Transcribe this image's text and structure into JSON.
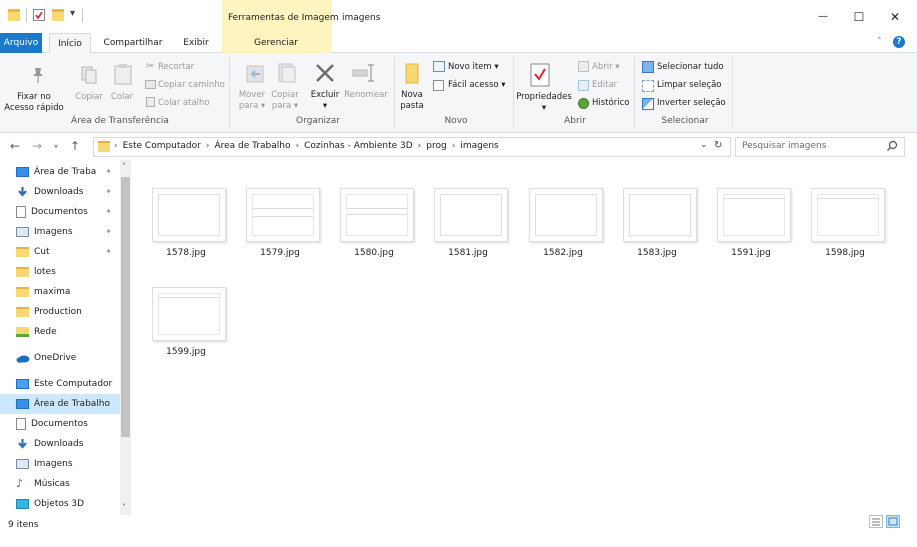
{
  "title_bar": {
    "context_tab_label": "Ferramentas de Imagem",
    "window_title": "imagens",
    "minimize_glyph": "—",
    "maximize_glyph": "☐",
    "close_glyph": "✕"
  },
  "ribbon_tabs": [
    {
      "label": "Arquivo"
    },
    {
      "label": "Início"
    },
    {
      "label": "Compartilhar"
    },
    {
      "label": "Exibir"
    },
    {
      "label": "Gerenciar"
    }
  ],
  "ribbon": {
    "clipboard": {
      "pin": "Fixar no\nAcesso rápido",
      "copy": "Copiar",
      "paste": "Colar",
      "cut": "Recortar",
      "copy_path": "Copiar caminho",
      "paste_shortcut": "Colar atalho",
      "group_label": "Área de Transferência"
    },
    "organize": {
      "move_to": "Mover\npara ▾",
      "copy_to": "Copiar\npara ▾",
      "delete": "Excluir\n▾",
      "rename": "Renomear",
      "group_label": "Organizar"
    },
    "new": {
      "new_folder": "Nova\npasta",
      "new_item": "Novo item ▾",
      "easy_access": "Fácil acesso ▾",
      "group_label": "Novo"
    },
    "open": {
      "properties": "Propriedades\n▾",
      "open": "Abrir ▾",
      "edit": "Editar",
      "history": "Histórico",
      "group_label": "Abrir"
    },
    "select": {
      "select_all": "Selecionar tudo",
      "select_none": "Limpar seleção",
      "invert": "Inverter seleção",
      "group_label": "Selecionar"
    }
  },
  "address": {
    "path": [
      "Este Computador",
      "Área de Trabalho",
      "Cozinhas - Ambiente 3D",
      "prog",
      "imagens"
    ],
    "search_placeholder": "Pesquisar imagens"
  },
  "nav_pane": {
    "items": [
      {
        "label": "Área de Traba",
        "icon": "desktop-icon",
        "pinned": true
      },
      {
        "label": "Downloads",
        "icon": "download-icon",
        "pinned": true
      },
      {
        "label": "Documentos",
        "icon": "documents-icon",
        "pinned": true
      },
      {
        "label": "Imagens",
        "icon": "pictures-icon",
        "pinned": true
      },
      {
        "label": "Cut",
        "icon": "folder-icon",
        "pinned": true
      },
      {
        "label": "lotes",
        "icon": "folder-icon",
        "pinned": false
      },
      {
        "label": "maxima",
        "icon": "folder-icon",
        "pinned": false
      },
      {
        "label": "Production",
        "icon": "folder-icon",
        "pinned": false
      },
      {
        "label": "Rede",
        "icon": "network-folder-icon",
        "pinned": false
      },
      {
        "label": "OneDrive",
        "icon": "onedrive-icon",
        "pinned": false
      },
      {
        "label": "Este Computador",
        "icon": "computer-icon",
        "pinned": false
      },
      {
        "label": "Área de Trabalho",
        "icon": "desktop-icon",
        "pinned": false,
        "selected": true
      },
      {
        "label": "Documentos",
        "icon": "documents-icon",
        "pinned": false
      },
      {
        "label": "Downloads",
        "icon": "download-icon",
        "pinned": false
      },
      {
        "label": "Imagens",
        "icon": "pictures-icon",
        "pinned": false
      },
      {
        "label": "Músicas",
        "icon": "music-icon",
        "pinned": false
      },
      {
        "label": "Objetos 3D",
        "icon": "3d-objects-icon",
        "pinned": false
      }
    ]
  },
  "files": [
    {
      "name": "1578.jpg",
      "variant": "plain"
    },
    {
      "name": "1579.jpg",
      "variant": "lines"
    },
    {
      "name": "1580.jpg",
      "variant": "lines"
    },
    {
      "name": "1581.jpg",
      "variant": "plain"
    },
    {
      "name": "1582.jpg",
      "variant": "plain"
    },
    {
      "name": "1583.jpg",
      "variant": "plain"
    },
    {
      "name": "1591.jpg",
      "variant": "topline"
    },
    {
      "name": "1598.jpg",
      "variant": "topline"
    },
    {
      "name": "1599.jpg",
      "variant": "topline"
    }
  ],
  "status": {
    "item_count": "9 itens"
  },
  "colors": {
    "file_tab": "#1979ca",
    "context_tab": "#fdf4bf",
    "selection": "#cce8ff",
    "folder": "#f8d775"
  }
}
